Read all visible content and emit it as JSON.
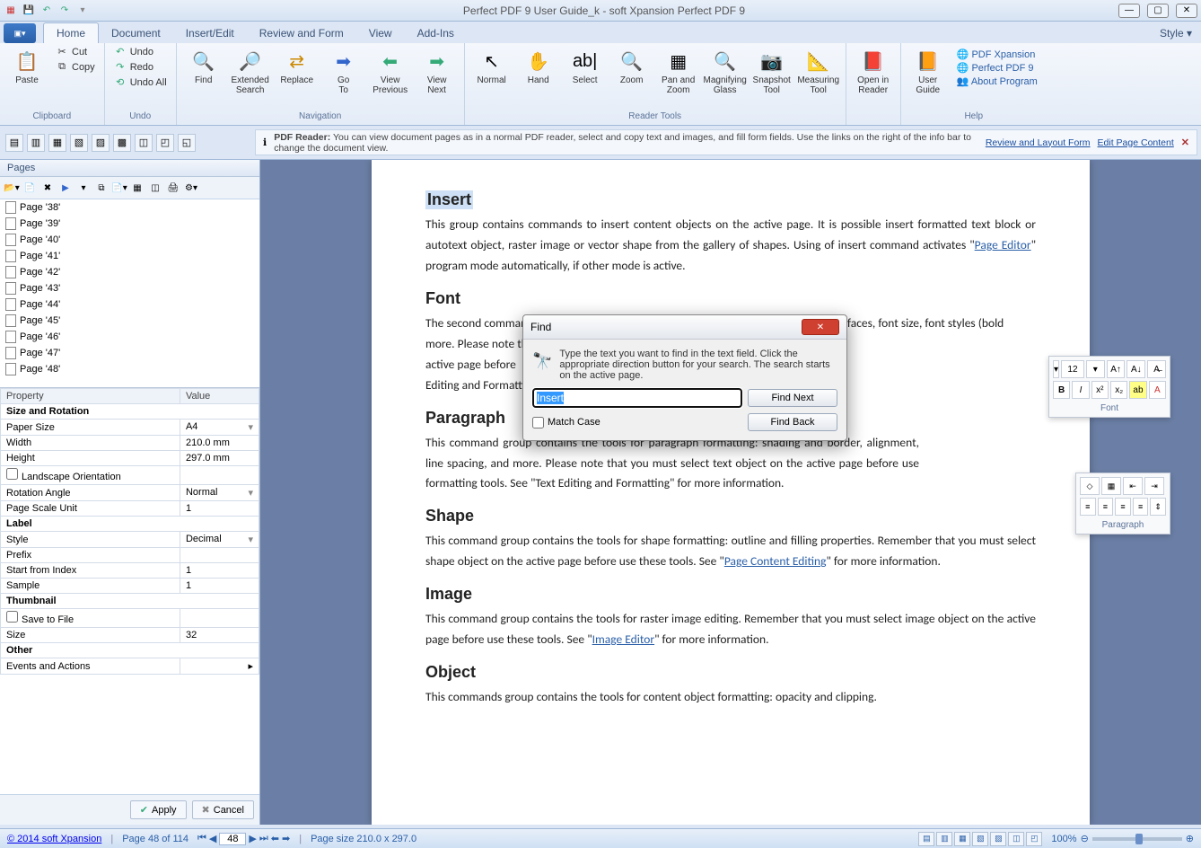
{
  "window": {
    "title": "Perfect PDF 9 User Guide_k - soft Xpansion Perfect PDF 9"
  },
  "tabs": [
    "Home",
    "Document",
    "Insert/Edit",
    "Review and Form",
    "View",
    "Add-Ins"
  ],
  "style_label": "Style",
  "ribbon": {
    "clipboard": {
      "label": "Clipboard",
      "paste": "Paste",
      "cut": "Cut",
      "copy": "Copy"
    },
    "undo": {
      "label": "Undo",
      "undo": "Undo",
      "redo": "Redo",
      "undo_all": "Undo All"
    },
    "navigation": {
      "label": "Navigation",
      "find": "Find",
      "ext_search": "Extended\nSearch",
      "replace": "Replace",
      "goto": "Go\nTo",
      "prev": "View\nPrevious",
      "next": "View\nNext"
    },
    "readertools": {
      "label": "Reader Tools",
      "normal": "Normal",
      "hand": "Hand",
      "select": "Select",
      "zoom": "Zoom",
      "panzoom": "Pan and\nZoom",
      "magnify": "Magnifying\nGlass",
      "snapshot": "Snapshot\nTool",
      "measure": "Measuring\nTool"
    },
    "open_reader": "Open in\nReader",
    "help": {
      "label": "Help",
      "guide": "User\nGuide",
      "links": [
        "PDF Xpansion",
        "Perfect PDF 9",
        "About Program"
      ]
    }
  },
  "info_bar": {
    "prefix": "PDF Reader:",
    "msg": "You can view document pages as in a normal PDF reader, select and copy text and images, and fill form fields. Use the links on the right of the info bar to change the document view.",
    "link1": "Review and Layout Form",
    "link2": "Edit Page Content"
  },
  "sidebar": {
    "title": "Pages",
    "pages": [
      "Page '38'",
      "Page '39'",
      "Page '40'",
      "Page '41'",
      "Page '42'",
      "Page '43'",
      "Page '44'",
      "Page '45'",
      "Page '46'",
      "Page '47'",
      "Page '48'"
    ],
    "prop_headers": [
      "Property",
      "Value"
    ],
    "props": [
      {
        "section": "Size and Rotation"
      },
      {
        "k": "Paper Size",
        "v": "A4",
        "dd": true
      },
      {
        "k": "Width",
        "v": "210.0 mm"
      },
      {
        "k": "Height",
        "v": "297.0 mm"
      },
      {
        "k": "Landscape Orientation",
        "v": "",
        "chk": true
      },
      {
        "k": "Rotation Angle",
        "v": "Normal",
        "dd": true
      },
      {
        "k": "Page Scale Unit",
        "v": "1"
      },
      {
        "section": "Label"
      },
      {
        "k": "Style",
        "v": "Decimal",
        "dd": true
      },
      {
        "k": "Prefix",
        "v": ""
      },
      {
        "k": "Start from Index",
        "v": "1"
      },
      {
        "k": "Sample",
        "v": "1"
      },
      {
        "section": "Thumbnail"
      },
      {
        "k": "Save to File",
        "v": "",
        "chk": true
      },
      {
        "k": "Size",
        "v": "32"
      },
      {
        "section": "Other"
      },
      {
        "k": "Events and Actions",
        "v": "",
        "arrow": true
      }
    ],
    "apply": "Apply",
    "cancel": "Cancel"
  },
  "document": {
    "h_insert": "Insert",
    "p_insert": "This group contains commands to insert content objects on the active page. It is possible insert formatted text block or autotext object, raster image or vector shape from the gallery of shapes. Using of insert command activates \"",
    "link_pe": "Page Editor",
    "p_insert2": "\" program mode automatically, if other mode is active.",
    "h_font": "Font",
    "p_font1": "The second command",
    "p_font2": "e font typefaces, font size, font styles (bold",
    "p_font3": "more. Please note that",
    "p_font4": "active page before",
    "p_font5": "Editing and Formatti",
    "p_font_tail": "ont",
    "h_para": "Paragraph",
    "p_para": "This command group contains the tools for paragraph formatting: shading and border, alignment, line spacing, and more. Please note that you must select text object on the active page before use formatting tools. See \"Text Editing and Formatting\" for more information.",
    "h_shape": "Shape",
    "p_shape1": "This command group contains the tools for shape formatting: outline and filling properties. Remember that you must select shape object on the active page before use these tools. See \"",
    "link_pce": "Page Content Editing",
    "p_shape2": "\" for more information.",
    "h_image": "Image",
    "p_image1": "This command group contains the tools for raster image editing. Remember that you must select image object on the active page before use these tools. See \"",
    "link_ie": "Image Editor",
    "p_image2": "\" for more information.",
    "h_object": "Object",
    "p_object": "This commands group contains the tools for content object formatting: opacity and clipping."
  },
  "font_panel": {
    "size": "12",
    "label": "ont"
  },
  "para_panel": {
    "label": "Paragraph"
  },
  "find_dialog": {
    "title": "Find",
    "hint": "Type the text you want to find in the text field. Click the appropriate direction button for your search. The search starts on the active page.",
    "value": "Insert",
    "match_case": "Match Case",
    "find_next": "Find Next",
    "find_back": "Find Back"
  },
  "status": {
    "copyright": "© 2014 soft Xpansion",
    "page_of": "Page 48 of 114",
    "page_input": "48",
    "page_size": "Page size 210.0 x 297.0",
    "zoom": "100%"
  }
}
